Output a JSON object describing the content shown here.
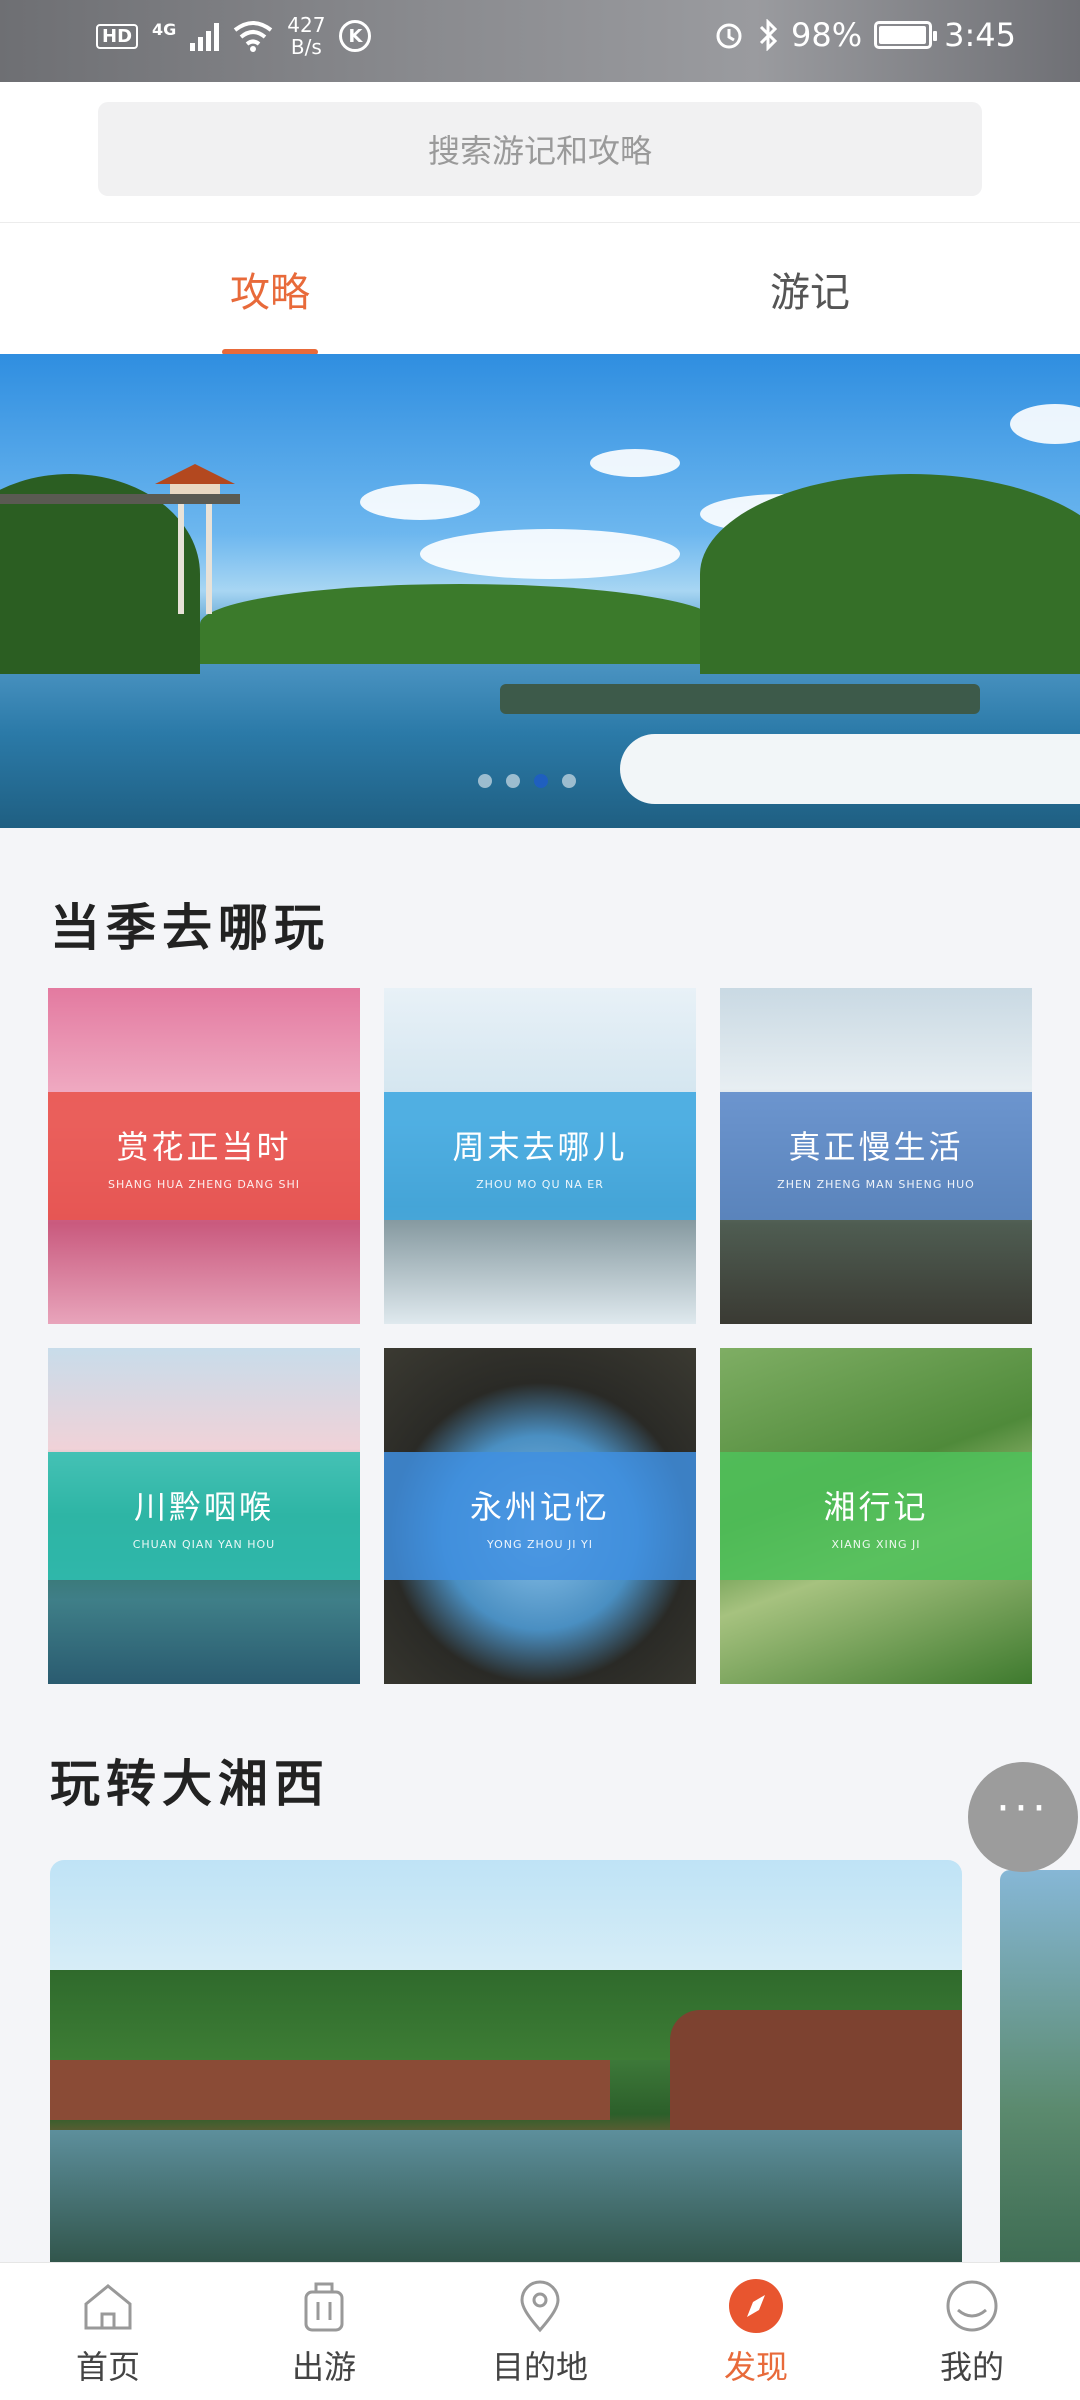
{
  "status_bar": {
    "hd": "HD",
    "network": "4G",
    "speed_value": "427",
    "speed_unit": "B/s",
    "k_badge": "K",
    "battery": "98%",
    "time": "3:45"
  },
  "search": {
    "placeholder": "搜索游记和攻略",
    "icon": "search-field"
  },
  "tabs": [
    {
      "label": "攻略",
      "active": true
    },
    {
      "label": "游记",
      "active": false
    }
  ],
  "banner": {
    "dot_count": 4,
    "active_dot_index": 2
  },
  "season_section": {
    "title": "当季去哪玩",
    "cards": [
      {
        "title": "赏花正当时",
        "pinyin": "SHANG HUA ZHENG DANG SHI",
        "band_color": "#e9554f"
      },
      {
        "title": "周末去哪儿",
        "pinyin": "ZHOU MO QU NA ER",
        "band_color": "#3ea7e0"
      },
      {
        "title": "真正慢生活",
        "pinyin": "ZHEN ZHENG MAN SHENG HUO",
        "band_color": "#5b89c9"
      },
      {
        "title": "川黔咽喉",
        "pinyin": "CHUAN QIAN YAN HOU",
        "band_color": "#2dbfb0"
      },
      {
        "title": "永州记忆",
        "pinyin": "YONG ZHOU JI YI",
        "band_color": "#3f8fe0"
      },
      {
        "title": "湘行记",
        "pinyin": "XIANG XING JI",
        "band_color": "#4fc05a"
      }
    ]
  },
  "xiangxi_section": {
    "title": "玩转大湘西"
  },
  "floating_button": {
    "icon": "more-dots-icon",
    "label": "···"
  },
  "bottom_nav": [
    {
      "label": "首页",
      "icon": "home-icon",
      "active": false
    },
    {
      "label": "出游",
      "icon": "luggage-icon",
      "active": false
    },
    {
      "label": "目的地",
      "icon": "location-pin-icon",
      "active": false
    },
    {
      "label": "发现",
      "icon": "compass-icon",
      "active": true
    },
    {
      "label": "我的",
      "icon": "profile-icon",
      "active": false
    }
  ],
  "colors": {
    "accent": "#e86a3a",
    "tab_inactive": "#555555"
  }
}
